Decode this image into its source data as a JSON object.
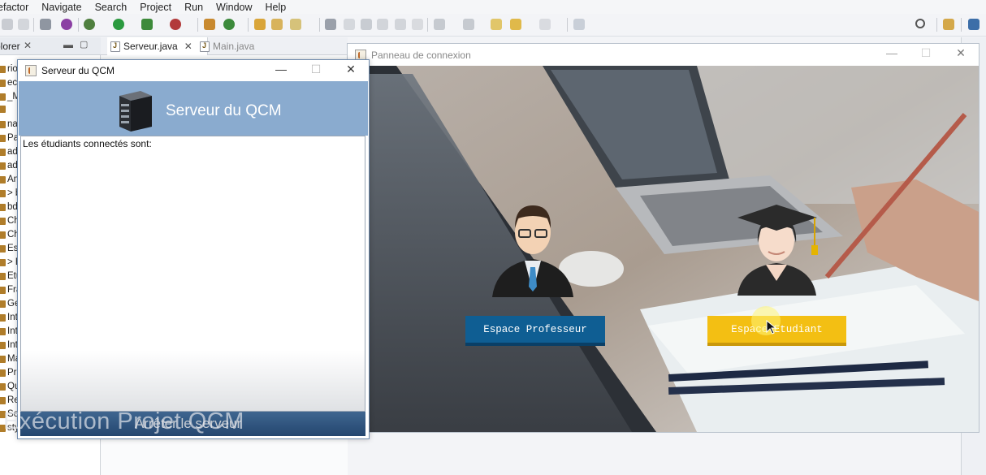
{
  "ide": {
    "menu": [
      "Refactor",
      "Navigate",
      "Search",
      "Project",
      "Run",
      "Window",
      "Help"
    ],
    "package_explorer": {
      "tab_label": "plorer",
      "tree_items": [
        "rio",
        "ect",
        "_Me",
        "",
        "nage",
        "Pac",
        "ado",
        "ado",
        "An",
        "> b",
        "bd",
        "Ch",
        "Ch",
        "Esp",
        "> E",
        "Etu",
        "Fra",
        "Ge",
        "Int",
        "Int",
        "Int",
        "Ma",
        "Pro",
        "Qu",
        "Resultats.java",
        "Serveur.java",
        "styleButton.java"
      ]
    },
    "editor_tabs": [
      {
        "label": "Serveur.java",
        "active": true
      },
      {
        "label": "Main.java",
        "active": false
      }
    ]
  },
  "server_window": {
    "title": "Serveur du QCM",
    "header_title": "Serveur du QCM",
    "list_label": "Les étudiants connectés sont:",
    "stop_button": "Arrêter le serveur"
  },
  "connexion_window": {
    "title": "Panneau de connexion",
    "professor_button": "Espace Professeur",
    "student_button": "Espace Etudiant"
  },
  "watermark": "Exécution Projet QCM",
  "colors": {
    "header_blue": "#8aabcf",
    "professor_button": "#0f5e93",
    "student_button": "#f3bf13",
    "stop_button": "#2e5580"
  }
}
